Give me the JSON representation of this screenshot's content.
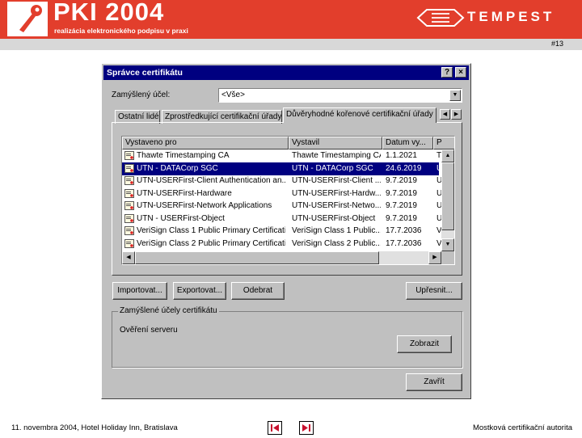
{
  "banner": {
    "title": "PKI 2004",
    "subtitle": "realizácia elektronického podpisu v praxi",
    "partner_logo_text": "TEMPEST",
    "slide_number": "#13",
    "colors": {
      "banner": "#e23e2c",
      "title_bar": "#000080"
    }
  },
  "dialog": {
    "title": "Správce certifikátu",
    "purpose_label": "Zamýšlený účel:",
    "purpose_value": "<Vše>",
    "tabs": [
      {
        "label": "Ostatní lidé",
        "active": false
      },
      {
        "label": "Zprostředkující certifikační úřady",
        "active": false
      },
      {
        "label": "Důvěryhodné kořenové certifikační úřady",
        "active": true
      }
    ],
    "columns": [
      "Vystaveno pro",
      "Vystavil",
      "Datum vy...",
      "P"
    ],
    "rows": [
      {
        "issued_to": "Thawte Timestamping CA",
        "issued_by": "Thawte Timestamping CA",
        "date": "1.1.2021",
        "p": "T",
        "selected": false
      },
      {
        "issued_to": "UTN - DATACorp SGC",
        "issued_by": "UTN - DATACorp SGC",
        "date": "24.6.2019",
        "p": "U",
        "selected": true
      },
      {
        "issued_to": "UTN-USERFirst-Client Authentication an...",
        "issued_by": "UTN-USERFirst-Client ...",
        "date": "9.7.2019",
        "p": "U",
        "selected": false
      },
      {
        "issued_to": "UTN-USERFirst-Hardware",
        "issued_by": "UTN-USERFirst-Hardw...",
        "date": "9.7.2019",
        "p": "U",
        "selected": false
      },
      {
        "issued_to": "UTN-USERFirst-Network Applications",
        "issued_by": "UTN-USERFirst-Netwo...",
        "date": "9.7.2019",
        "p": "U",
        "selected": false
      },
      {
        "issued_to": "UTN - USERFirst-Object",
        "issued_by": "UTN-USERFirst-Object",
        "date": "9.7.2019",
        "p": "U",
        "selected": false
      },
      {
        "issued_to": "VeriSign Class 1 Public Primary Certificati...",
        "issued_by": "VeriSign Class 1 Public...",
        "date": "17.7.2036",
        "p": "V",
        "selected": false
      },
      {
        "issued_to": "VeriSign Class 2 Public Primary Certificati...",
        "issued_by": "VeriSign Class 2 Public...",
        "date": "17.7.2036",
        "p": "V",
        "selected": false
      }
    ],
    "buttons": {
      "import": "Importovat...",
      "export": "Exportovat...",
      "remove": "Odebrat",
      "advanced": "Upřesnit...",
      "view": "Zobrazit",
      "close": "Zavřít"
    },
    "group_title": "Zamýšlené účely certifikátu",
    "group_value": "Ověření serveru"
  },
  "footer": {
    "left": "11. novembra 2004, Hotel Holiday Inn, Bratislava",
    "right": "Mostková certifikační autorita"
  }
}
